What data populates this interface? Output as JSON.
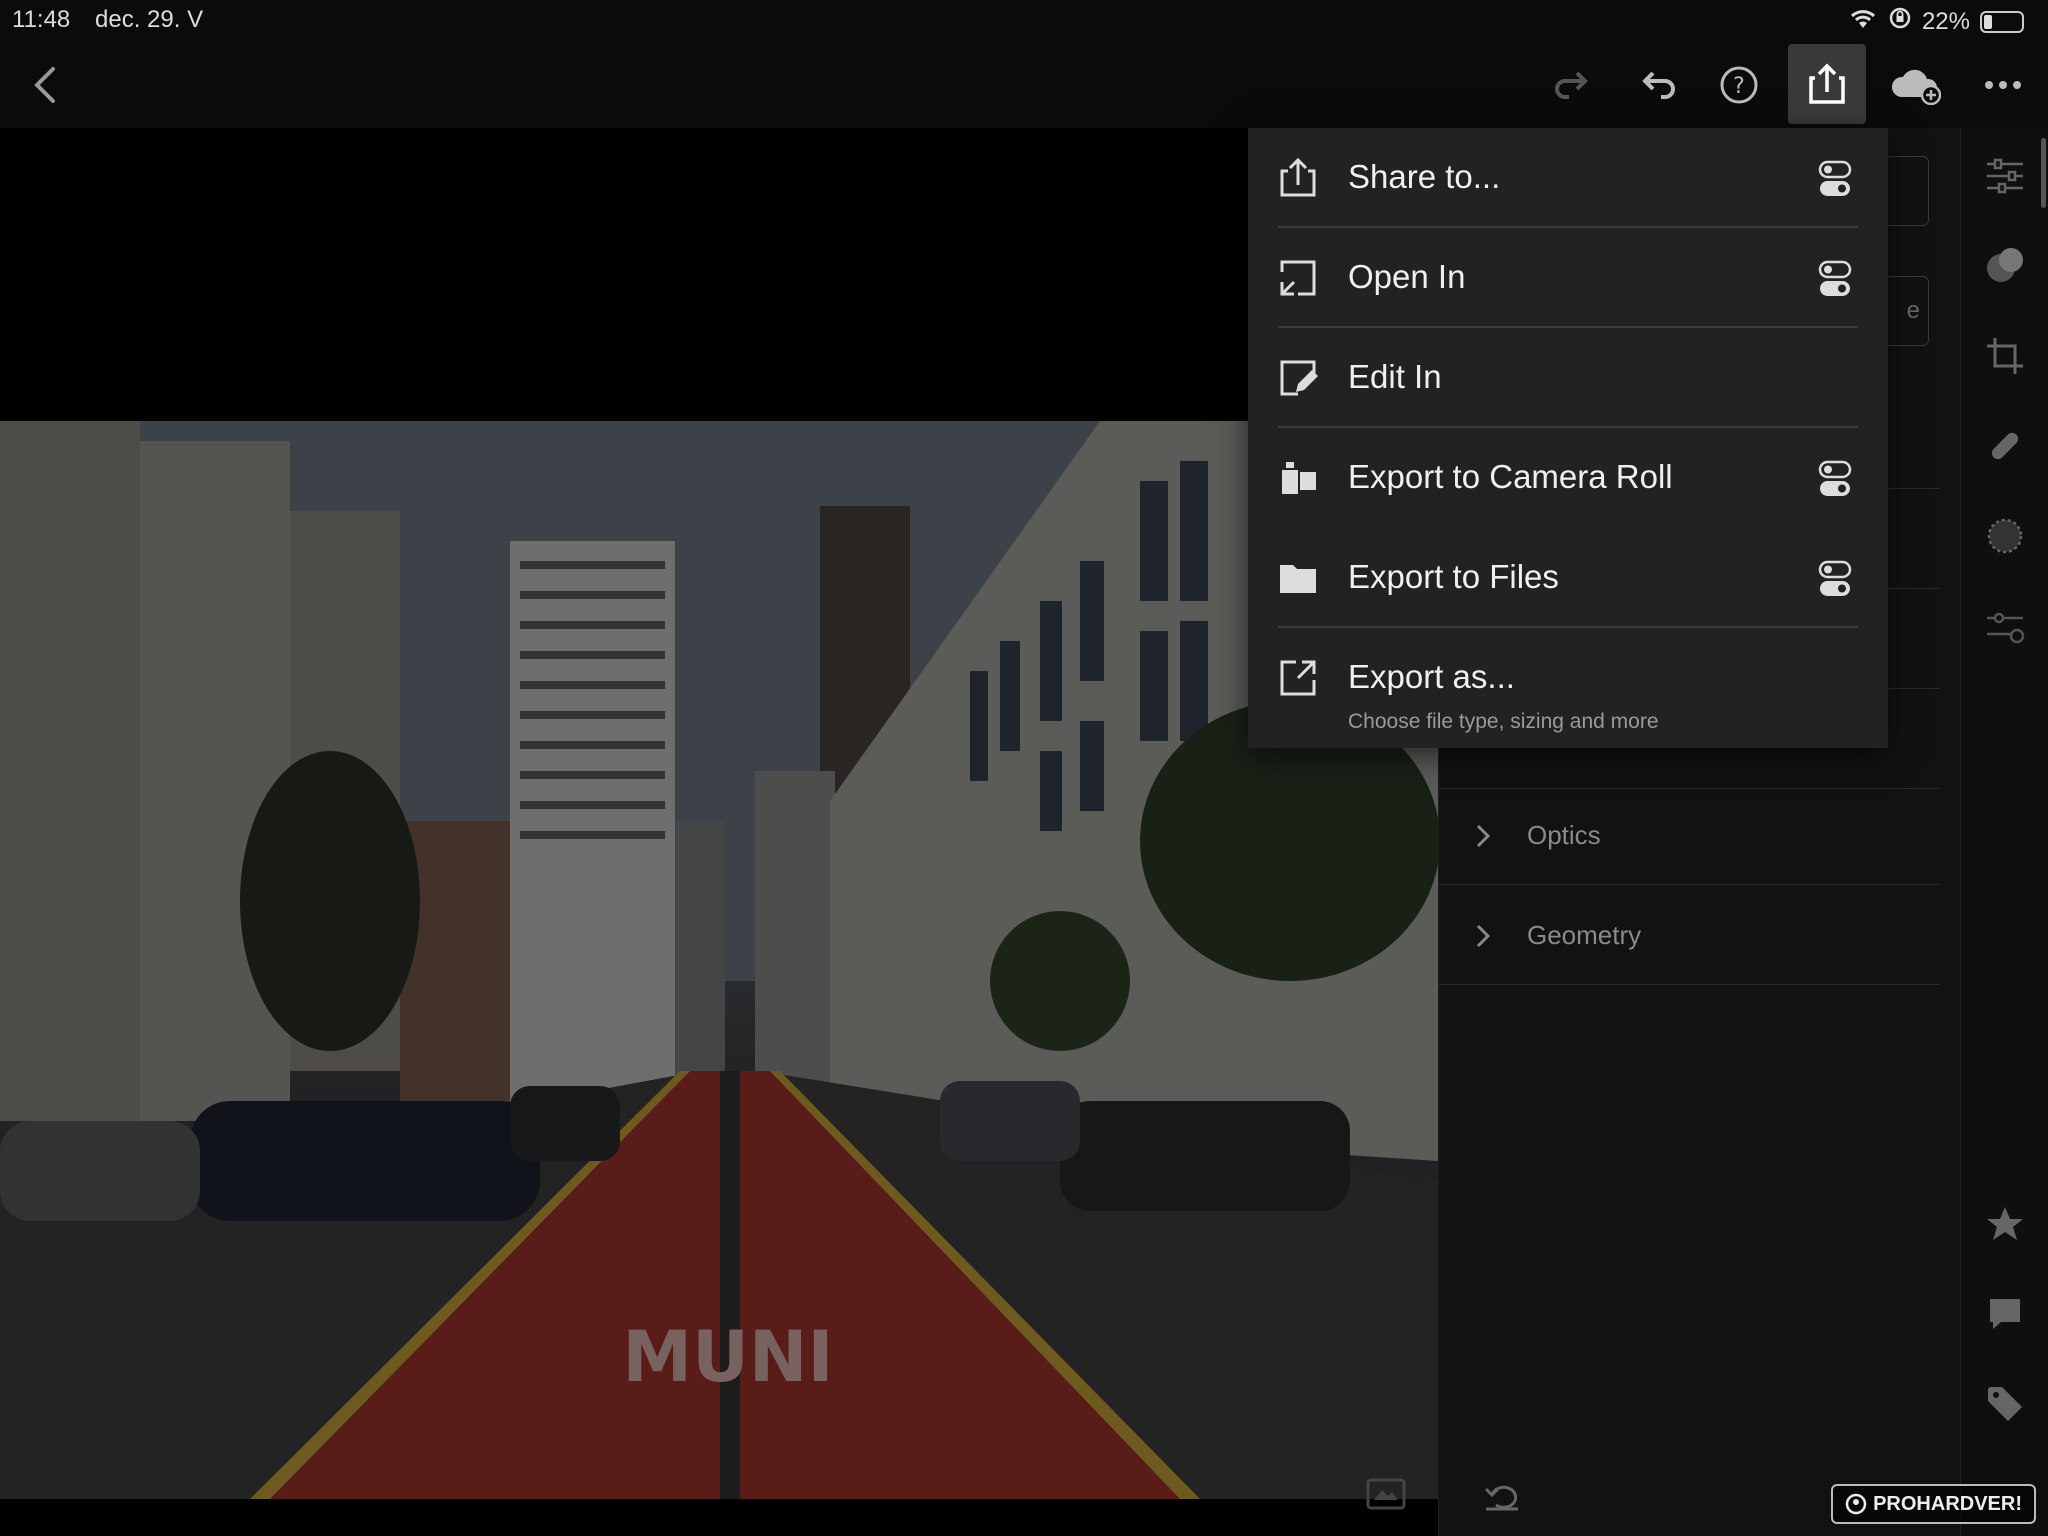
{
  "status_bar": {
    "time": "11:48",
    "date": "dec. 29. V",
    "battery": "22%"
  },
  "menu": {
    "items": [
      {
        "label": "Share to...",
        "icon": "share-icon",
        "has_toggle": true
      },
      {
        "label": "Open In",
        "icon": "open-in-icon",
        "has_toggle": true
      },
      {
        "label": "Edit In",
        "icon": "edit-in-icon",
        "has_toggle": false
      },
      {
        "label": "Export to Camera Roll",
        "icon": "camera-roll-icon",
        "has_toggle": true
      },
      {
        "label": "Export to Files",
        "icon": "folder-icon",
        "has_toggle": true
      },
      {
        "label": "Export as...",
        "icon": "export-as-icon",
        "has_toggle": false,
        "subtitle": "Choose file type, sizing and more"
      }
    ]
  },
  "panel": {
    "sections": [
      {
        "label": "Optics"
      },
      {
        "label": "Geometry"
      }
    ],
    "box_fragment": "e"
  },
  "watermark": "PROHARDVER!",
  "colors": {
    "menu_bg": "#222222",
    "panel_bg": "#121212",
    "active_button": "#3a3a3a"
  }
}
